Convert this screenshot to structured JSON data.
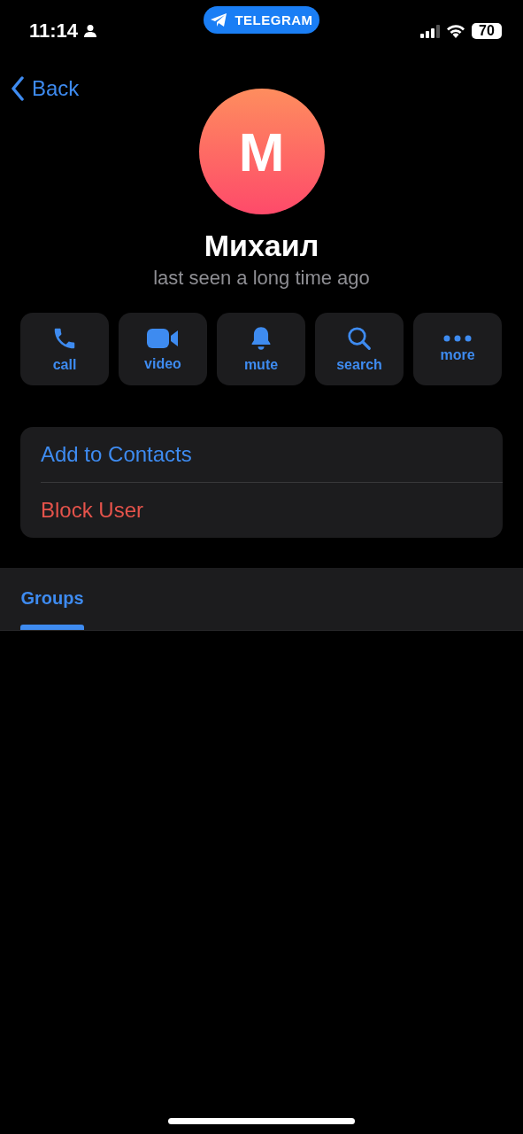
{
  "status_bar": {
    "time": "11:14",
    "app_pill": "TELEGRAM",
    "battery": "70"
  },
  "nav": {
    "back": "Back"
  },
  "profile": {
    "initial": "M",
    "name": "Михаил",
    "status": "last seen a long time ago"
  },
  "actions": [
    {
      "kind": "call",
      "label": "call"
    },
    {
      "kind": "video",
      "label": "video"
    },
    {
      "kind": "mute",
      "label": "mute"
    },
    {
      "kind": "search",
      "label": "search"
    },
    {
      "kind": "more",
      "label": "more"
    }
  ],
  "menu": [
    {
      "kind": "default",
      "label": "Add to Contacts"
    },
    {
      "kind": "destructive",
      "label": "Block User"
    }
  ],
  "tabs": [
    {
      "label": "Groups",
      "selected": true
    }
  ]
}
